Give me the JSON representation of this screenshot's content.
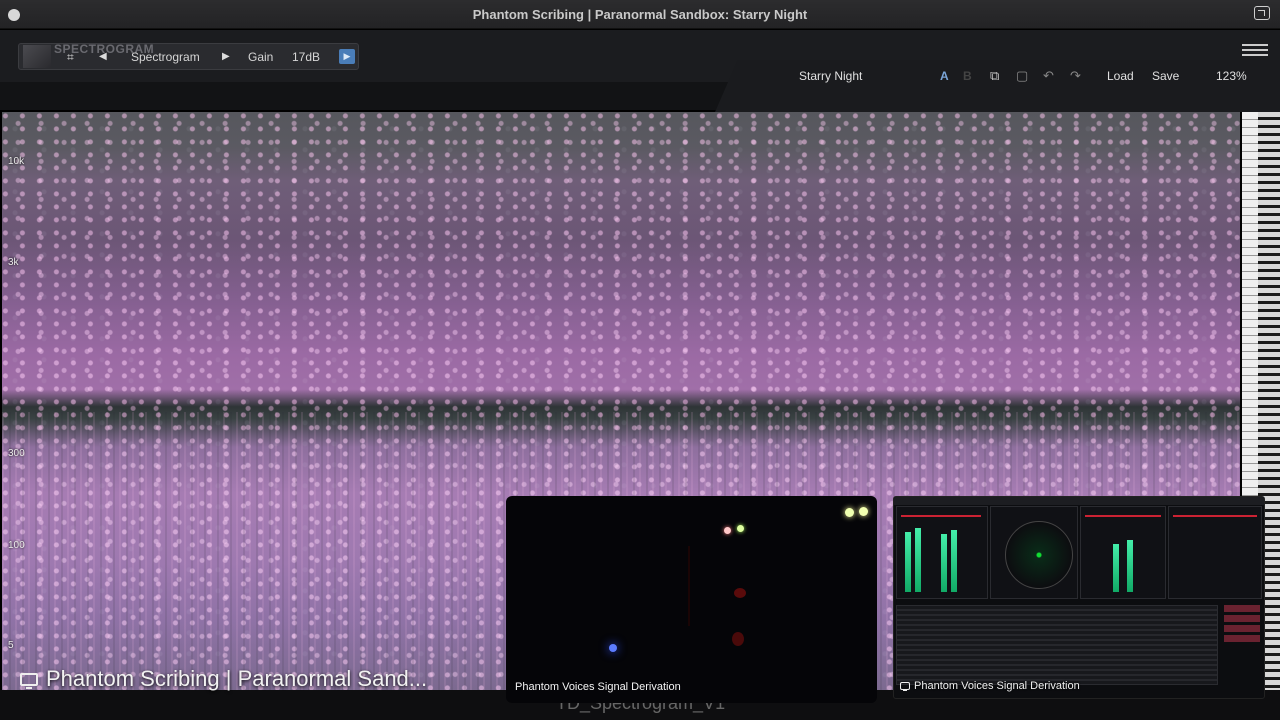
{
  "window": {
    "title": "Phantom Scribing | Paranormal Sandbox: Starry Night"
  },
  "plugin": {
    "module_name": "Spectrogram",
    "gain_label": "Gain",
    "gain_value": "17dB",
    "ghost_logo_text": "SPECTROGRAM",
    "preset_name": "Starry Night",
    "ab_a": "A",
    "ab_b": "B",
    "load_label": "Load",
    "save_label": "Save",
    "zoom": "123%"
  },
  "spectrogram": {
    "freq_labels": [
      "10k",
      "3k",
      "300",
      "100",
      "5"
    ]
  },
  "overlays": {
    "main_window_label": "Phantom Scribing | Paranormal Sand...",
    "ghost_text": "TD_Spectrogram_V1",
    "video_caption": "Phantom Voices Signal Derivation",
    "meter_caption": "Phantom Voices Signal Derivation"
  },
  "colors": {
    "accent": "#4a7db8",
    "spectrogram_pink": "#e6a0d8",
    "meter_green": "#44ddaa",
    "meter_red": "#cc2233"
  }
}
